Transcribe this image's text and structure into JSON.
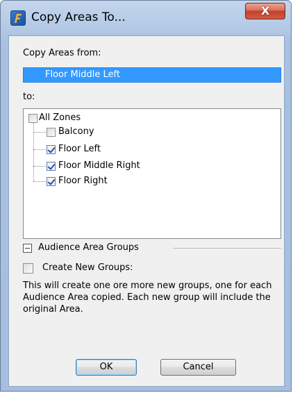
{
  "window": {
    "title": "Copy Areas To...",
    "close_label": "X"
  },
  "copy_from": {
    "label": "Copy Areas from:",
    "value": "Floor Middle Left"
  },
  "to": {
    "label": "to:",
    "tree": {
      "root": {
        "label": "All Zones",
        "checked": false
      },
      "children": [
        {
          "label": "Balcony",
          "checked": false
        },
        {
          "label": "Floor Left",
          "checked": true
        },
        {
          "label": "Floor Middle Right",
          "checked": true
        },
        {
          "label": "Floor Right",
          "checked": true
        }
      ]
    }
  },
  "groups": {
    "section_label": "Audience Area Groups",
    "create_label": "Create New Groups:",
    "create_checked": false,
    "description": "This will create one ore more new groups, one for each Audience Area copied. Each new group will include the original Area."
  },
  "buttons": {
    "ok": "OK",
    "cancel": "Cancel"
  },
  "icons": {
    "app": "app-logo-icon",
    "close": "close-icon",
    "collapse": "collapse-minus-icon"
  }
}
